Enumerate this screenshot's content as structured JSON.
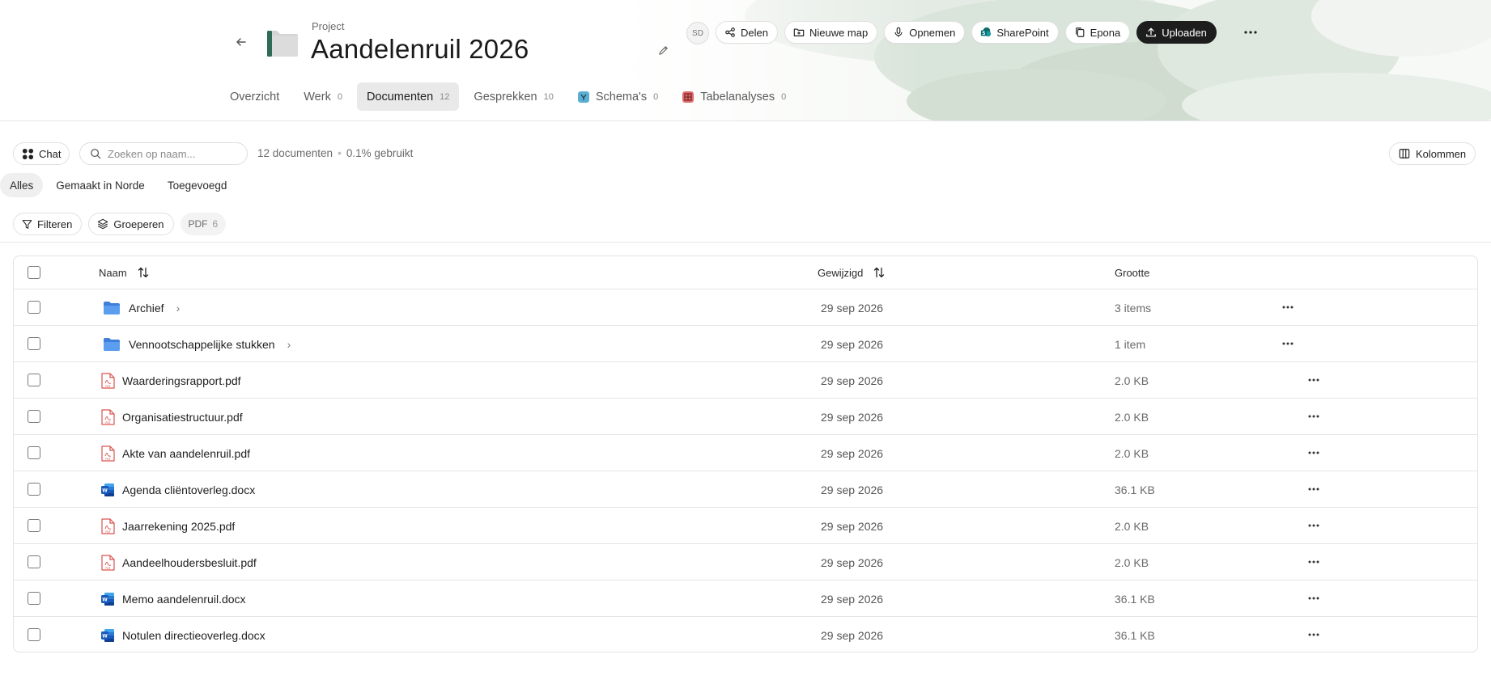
{
  "header": {
    "project_label": "Project",
    "title": "Aandelenruil 2026",
    "avatar_initials": "SD",
    "actions": [
      {
        "label": "Delen",
        "icon": "share-icon"
      },
      {
        "label": "Nieuwe map",
        "icon": "folder-plus-icon"
      },
      {
        "label": "Opnemen",
        "icon": "microphone-icon"
      },
      {
        "label": "SharePoint",
        "icon": "sharepoint-icon"
      },
      {
        "label": "Epona",
        "icon": "copy-icon"
      },
      {
        "label": "Uploaden",
        "icon": "upload-icon"
      }
    ]
  },
  "tabs": [
    {
      "label": "Overzicht",
      "count": ""
    },
    {
      "label": "Werk",
      "count": "0"
    },
    {
      "label": "Documenten",
      "count": "12"
    },
    {
      "label": "Gesprekken",
      "count": "10"
    },
    {
      "label": "Schema's",
      "count": "0"
    },
    {
      "label": "Tabelanalyses",
      "count": "0"
    }
  ],
  "toolbar": {
    "chat_label": "Chat",
    "search_placeholder": "Zoeken op naam...",
    "doc_count": "12 documenten",
    "usage": "0.1% gebruikt",
    "columns_label": "Kolommen"
  },
  "subtabs": [
    "Alles",
    "Gemaakt in Norde",
    "Toegevoegd"
  ],
  "filters": {
    "filter_label": "Filteren",
    "group_label": "Groeperen",
    "chip_label": "PDF",
    "chip_count": "6"
  },
  "table": {
    "columns": {
      "name": "Naam",
      "modified": "Gewijzigd",
      "size": "Grootte"
    },
    "rows": [
      {
        "type": "folder",
        "name": "Archief",
        "modified": "29 sep 2026",
        "size": "3 items"
      },
      {
        "type": "folder",
        "name": "Vennootschappelijke stukken",
        "modified": "29 sep 2026",
        "size": "1 item"
      },
      {
        "type": "pdf",
        "name": "Waarderingsrapport.pdf",
        "modified": "29 sep 2026",
        "size": "2.0 KB"
      },
      {
        "type": "pdf",
        "name": "Organisatiestructuur.pdf",
        "modified": "29 sep 2026",
        "size": "2.0 KB"
      },
      {
        "type": "pdf",
        "name": "Akte van aandelenruil.pdf",
        "modified": "29 sep 2026",
        "size": "2.0 KB"
      },
      {
        "type": "docx",
        "name": "Agenda cliëntoverleg.docx",
        "modified": "29 sep 2026",
        "size": "36.1 KB"
      },
      {
        "type": "pdf",
        "name": "Jaarrekening 2025.pdf",
        "modified": "29 sep 2026",
        "size": "2.0 KB"
      },
      {
        "type": "pdf",
        "name": "Aandeelhoudersbesluit.pdf",
        "modified": "29 sep 2026",
        "size": "2.0 KB"
      },
      {
        "type": "docx",
        "name": "Memo aandelenruil.docx",
        "modified": "29 sep 2026",
        "size": "36.1 KB"
      },
      {
        "type": "docx",
        "name": "Notulen directieoverleg.docx",
        "modified": "29 sep 2026",
        "size": "36.1 KB"
      }
    ]
  },
  "colors": {
    "accent_dark": "#1d1d1d",
    "folder_blue": "#4a8be0",
    "pdf_red": "#d9534f",
    "word_blue": "#1d63c7"
  }
}
